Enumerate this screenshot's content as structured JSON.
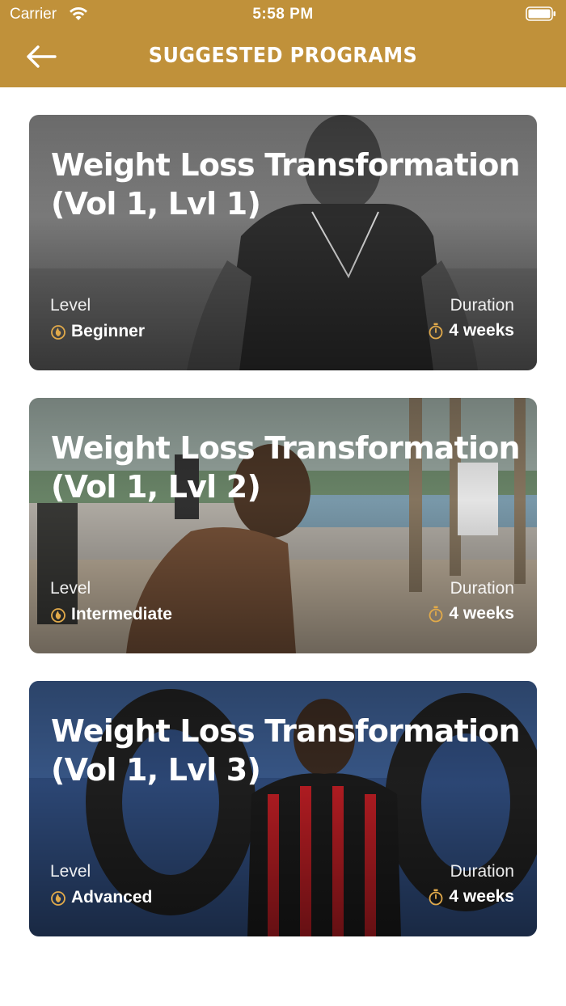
{
  "status_bar": {
    "carrier": "Carrier",
    "time": "5:58 PM"
  },
  "header": {
    "title": "SUGGESTED PROGRAMS",
    "back_icon": "arrow-left-icon"
  },
  "colors": {
    "header_bg": "#c0913a",
    "accent_icon": "#e0a94a"
  },
  "programs": [
    {
      "title": "Weight Loss Transformation (Vol 1, Lvl 1)",
      "level_label": "Level",
      "level": "Beginner",
      "duration_label": "Duration",
      "duration": "4 weeks",
      "level_icon": "flame-icon",
      "duration_icon": "stopwatch-icon"
    },
    {
      "title": "Weight Loss Transformation (Vol 1, Lvl 2)",
      "level_label": "Level",
      "level": "Intermediate",
      "duration_label": "Duration",
      "duration": "4 weeks",
      "level_icon": "flame-icon",
      "duration_icon": "stopwatch-icon"
    },
    {
      "title": "Weight Loss Transformation (Vol 1, Lvl 3)",
      "level_label": "Level",
      "level": "Advanced",
      "duration_label": "Duration",
      "duration": "4 weeks",
      "level_icon": "flame-icon",
      "duration_icon": "stopwatch-icon"
    }
  ]
}
